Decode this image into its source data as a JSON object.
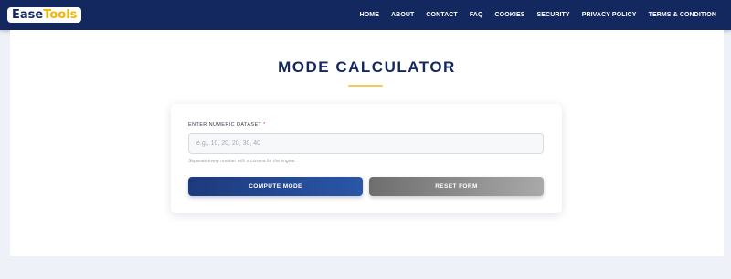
{
  "brand": {
    "part1": "Ease",
    "part2": "Tools"
  },
  "nav": {
    "items": [
      {
        "label": "HOME"
      },
      {
        "label": "ABOUT"
      },
      {
        "label": "CONTACT"
      },
      {
        "label": "FAQ"
      },
      {
        "label": "COOKIES"
      },
      {
        "label": "SECURITY"
      },
      {
        "label": "PRIVACY POLICY"
      },
      {
        "label": "TERMS & CONDITION"
      }
    ]
  },
  "page": {
    "title": "MODE CALCULATOR"
  },
  "form": {
    "label": "ENTER NUMERIC DATASET",
    "required_mark": "*",
    "input_value": "",
    "placeholder": "e.g., 10, 20, 20, 30, 40",
    "helper": "Separate every number with a comma for the engine.",
    "compute_label": "COMPUTE MODE",
    "reset_label": "RESET FORM"
  },
  "colors": {
    "navbar": "#13285f",
    "accent_gold": "#f4b400",
    "primary_button": "#2a56a6",
    "secondary_button": "#8a8a8a"
  }
}
